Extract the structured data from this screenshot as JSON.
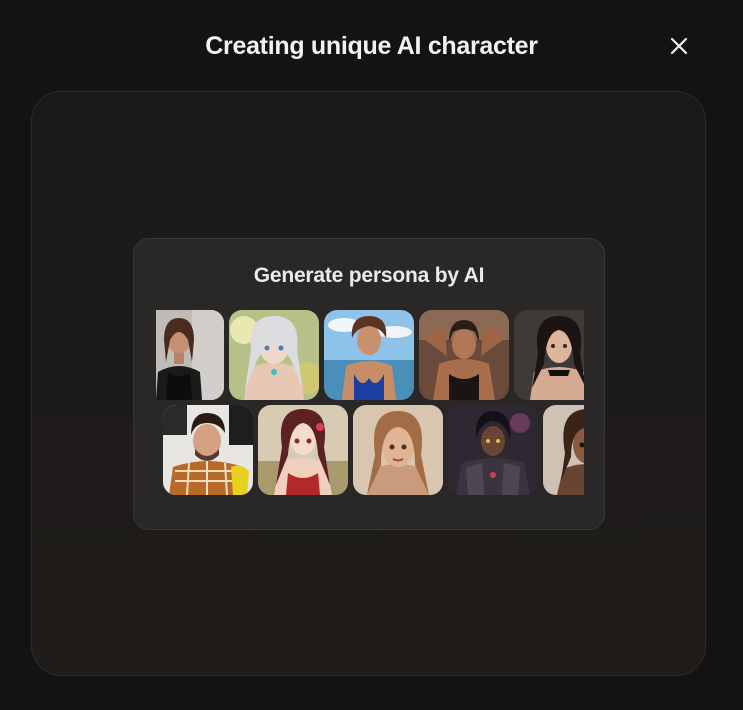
{
  "dialog": {
    "title": "Creating unique AI character",
    "close_icon": "close-icon"
  },
  "card": {
    "title": "Generate persona by AI"
  },
  "gallery": {
    "row1": [
      {
        "name": "portrait-woman-black-dress"
      },
      {
        "name": "portrait-anime-silver-hair"
      },
      {
        "name": "portrait-woman-blue-swimsuit"
      },
      {
        "name": "portrait-fantasy-bronze-woman"
      },
      {
        "name": "portrait-woman-dark-curls"
      }
    ],
    "row2": [
      {
        "name": "portrait-man-plaid-shirt"
      },
      {
        "name": "portrait-anime-red-dress"
      },
      {
        "name": "portrait-woman-light-brown-hair"
      },
      {
        "name": "portrait-fantasy-dark-armor"
      },
      {
        "name": "portrait-woman-curly-hair"
      }
    ]
  }
}
